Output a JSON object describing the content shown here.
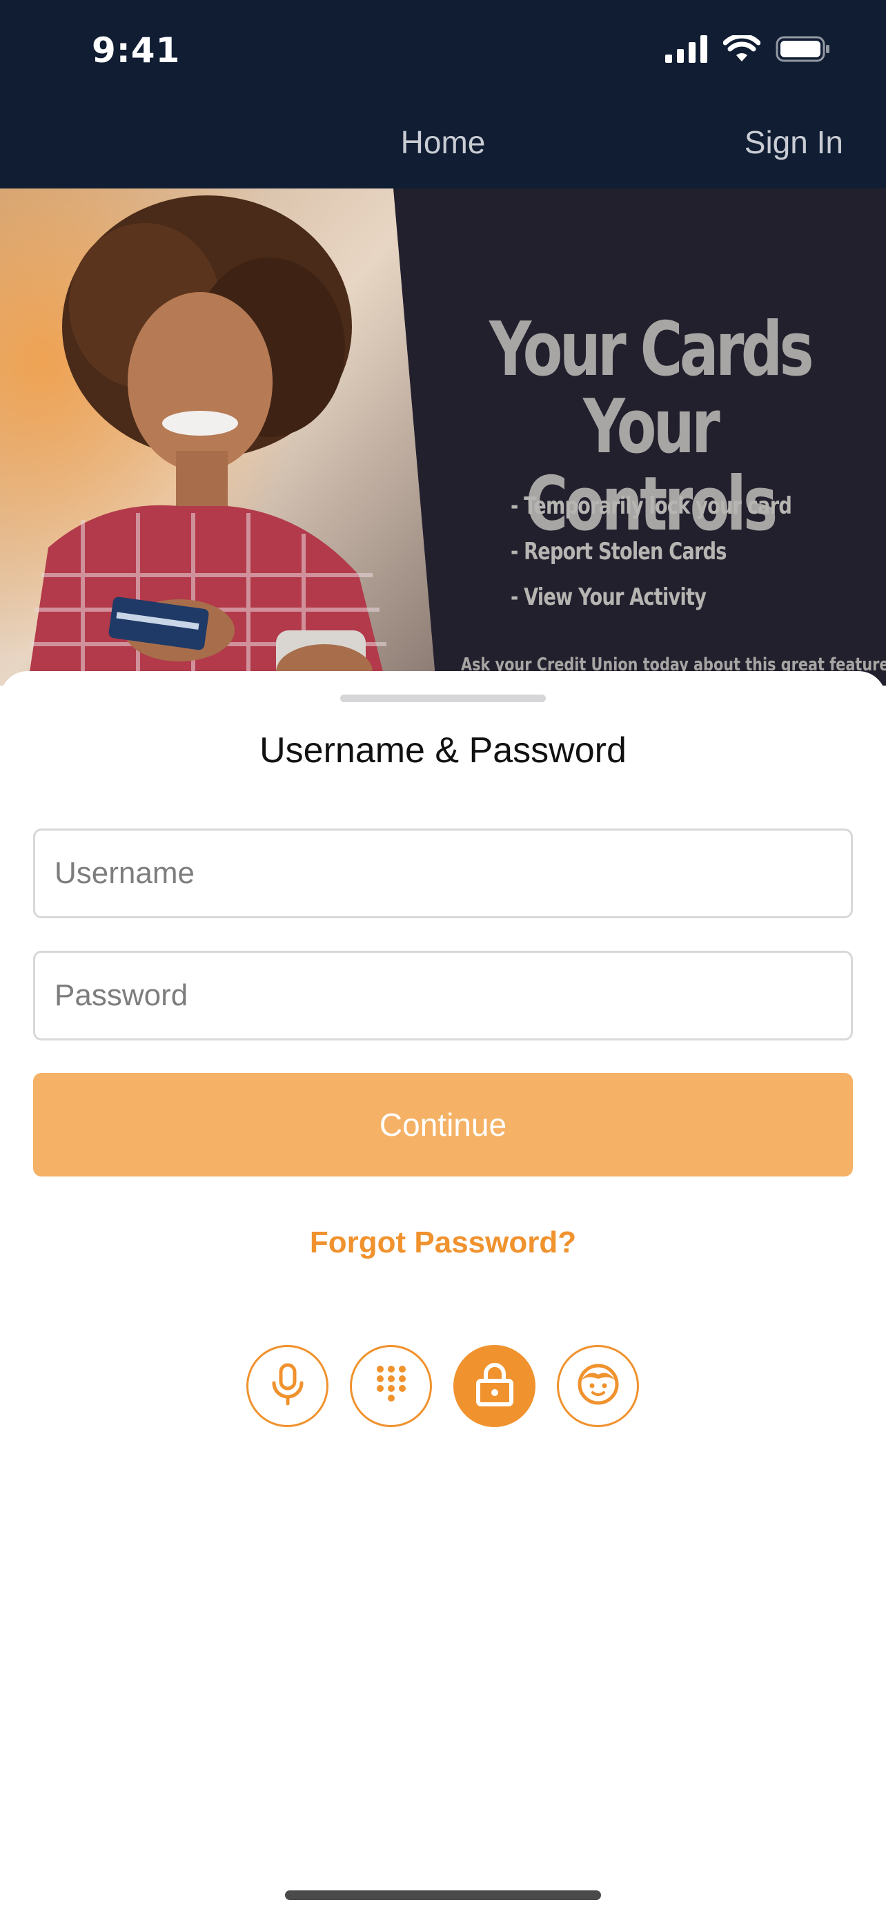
{
  "status_bar": {
    "time": "9:41"
  },
  "nav": {
    "home_label": "Home",
    "signin_label": "Sign In"
  },
  "hero": {
    "title_line1": "Your Cards",
    "title_line2": "Your Controls",
    "bullets": [
      "- Temporarily lock your card",
      "- Report Stolen Cards",
      "- View Your Activity"
    ],
    "footnote": "Ask your Credit Union today about this great feature!"
  },
  "login": {
    "title": "Username & Password",
    "username_placeholder": "Username",
    "password_placeholder": "Password",
    "continue_label": "Continue",
    "forgot_label": "Forgot Password?"
  },
  "auth_methods": [
    {
      "icon": "microphone-icon",
      "active": false
    },
    {
      "icon": "keypad-icon",
      "active": false
    },
    {
      "icon": "lock-icon",
      "active": true
    },
    {
      "icon": "face-icon",
      "active": false
    }
  ],
  "colors": {
    "nav_bg": "#101d33",
    "accent": "#f0922e",
    "button": "#f5b266",
    "hero_bg": "#23202e"
  }
}
